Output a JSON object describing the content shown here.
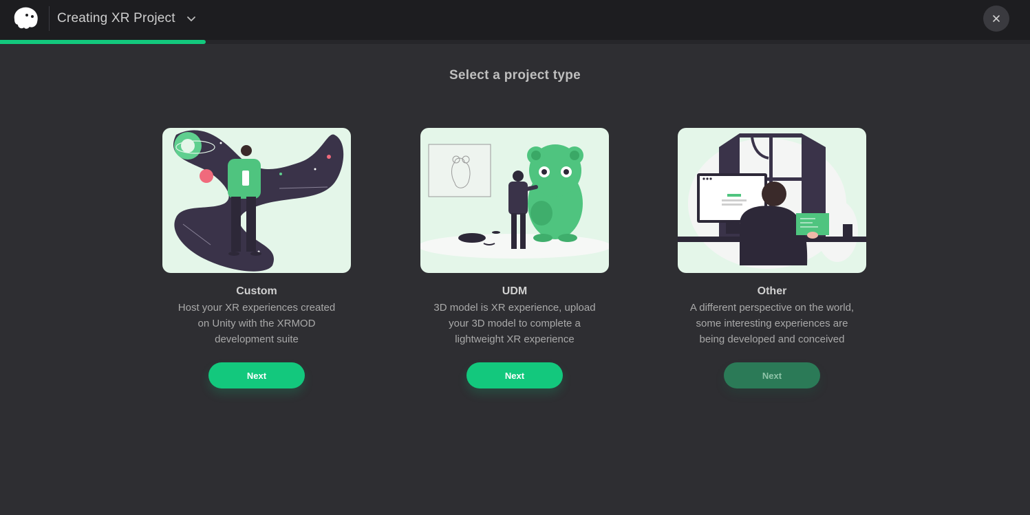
{
  "header": {
    "title": "Creating XR Project",
    "logo_icon": "ghost-logo-icon",
    "dropdown_icon": "chevron-down-icon",
    "close_icon": "close-icon"
  },
  "progress": {
    "fraction": 0.2,
    "color": "#13c87d"
  },
  "heading": "Select a project type",
  "cards": [
    {
      "name": "Custom",
      "description": "Host your XR experiences created on Unity with the XRMOD development suite",
      "button_label": "Next",
      "enabled": true
    },
    {
      "name": "UDM",
      "description": "3D model is XR experience, upload your 3D model to complete a lightweight XR experience",
      "button_label": "Next",
      "enabled": true
    },
    {
      "name": "Other",
      "description": "A different perspective on the world, some interesting experiences are being developed and conceived",
      "button_label": "Next",
      "enabled": false
    }
  ],
  "colors": {
    "accent": "#13c87d",
    "accent_disabled": "#2b7a57",
    "background": "#2e2e32",
    "topbar": "#1d1d20",
    "card_illustration_bg": "#e4f6e9"
  }
}
